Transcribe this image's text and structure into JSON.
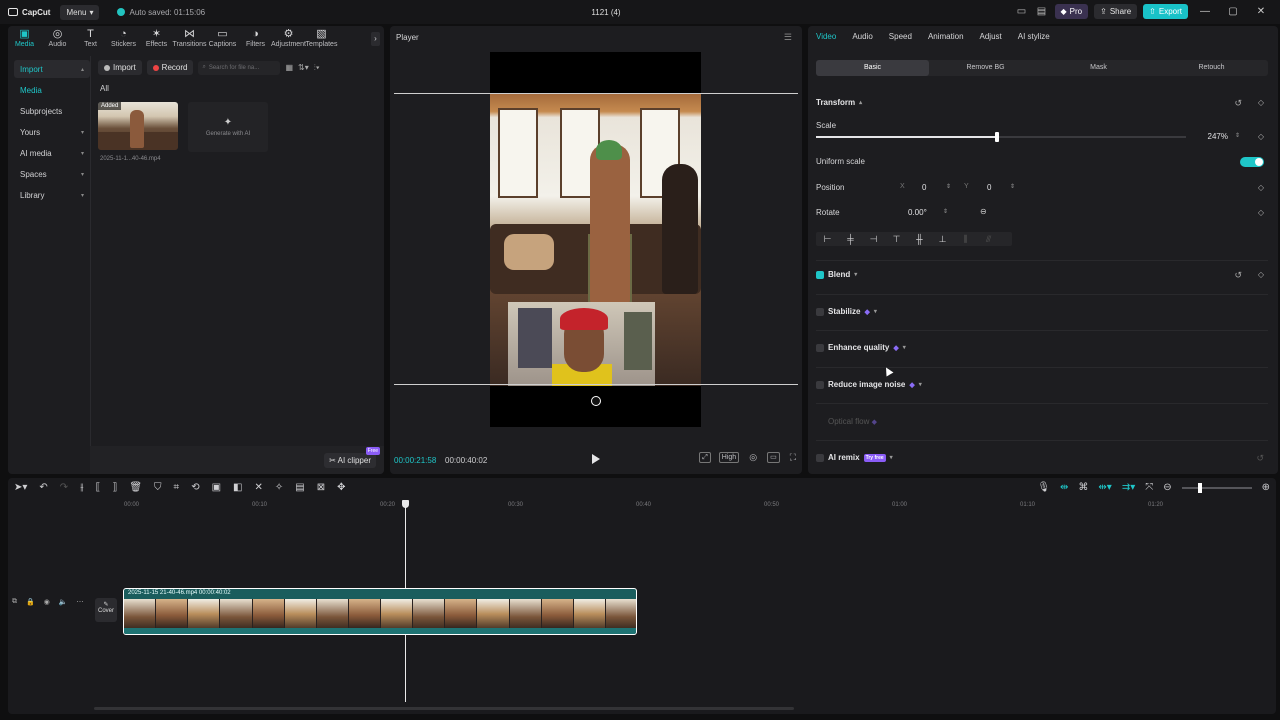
{
  "titlebar": {
    "app_name": "CapCut",
    "menu_label": "Menu",
    "autosave": "Auto saved: 01:15:06",
    "project_title": "1121 (4)",
    "pro_label": "Pro",
    "share_label": "Share",
    "export_label": "Export"
  },
  "tool_tabs": [
    {
      "label": "Media",
      "icon": "media-icon"
    },
    {
      "label": "Audio",
      "icon": "audio-icon"
    },
    {
      "label": "Text",
      "icon": "text-icon"
    },
    {
      "label": "Stickers",
      "icon": "sticker-icon"
    },
    {
      "label": "Effects",
      "icon": "effects-icon"
    },
    {
      "label": "Transitions",
      "icon": "transitions-icon"
    },
    {
      "label": "Captions",
      "icon": "captions-icon"
    },
    {
      "label": "Filters",
      "icon": "filters-icon"
    },
    {
      "label": "Adjustment",
      "icon": "adjustment-icon"
    },
    {
      "label": "Templates",
      "icon": "templates-icon"
    }
  ],
  "side_nav": {
    "import": "Import",
    "media": "Media",
    "subprojects": "Subprojects",
    "yours": "Yours",
    "ai_media": "AI media",
    "spaces": "Spaces",
    "library": "Library"
  },
  "media": {
    "import_btn": "Import",
    "record_btn": "Record",
    "search_placeholder": "Search for file na...",
    "all_label": "All",
    "added_tag": "Added",
    "file_name": "2025-11-1...40-46.mp4",
    "generate_label": "Generate with AI",
    "ai_clipper": "AI clipper",
    "free_badge": "Free"
  },
  "player": {
    "title": "Player",
    "time_current": "00:00:21:58",
    "time_total": "00:00:40:02",
    "high_label": "High"
  },
  "props": {
    "tabs": [
      "Video",
      "Audio",
      "Speed",
      "Animation",
      "Adjust",
      "AI stylize"
    ],
    "subtabs": [
      "Basic",
      "Remove BG",
      "Mask",
      "Retouch"
    ],
    "transform": "Transform",
    "scale": "Scale",
    "scale_value": "247%",
    "scale_fraction": 0.49,
    "uniform_scale": "Uniform scale",
    "position": "Position",
    "pos_x_label": "X",
    "pos_x": "0",
    "pos_y_label": "Y",
    "pos_y": "0",
    "rotate": "Rotate",
    "rotate_value": "0.00°",
    "blend": "Blend",
    "stabilize": "Stabilize",
    "enhance_quality": "Enhance quality",
    "reduce_noise": "Reduce image noise",
    "optical_flow": "Optical flow",
    "ai_remix": "AI remix",
    "try_free": "Try free"
  },
  "timeline": {
    "ticks": [
      "00:00",
      "00:10",
      "00:20",
      "00:30",
      "00:40",
      "00:50",
      "01:00",
      "01:10",
      "01:20"
    ],
    "clip_label": "2025-11-15 21-40-46.mp4   00:00:40:02",
    "cover_label": "Cover"
  },
  "colors": {
    "accent": "#1fc6c8",
    "pro": "#8a5cf6"
  }
}
